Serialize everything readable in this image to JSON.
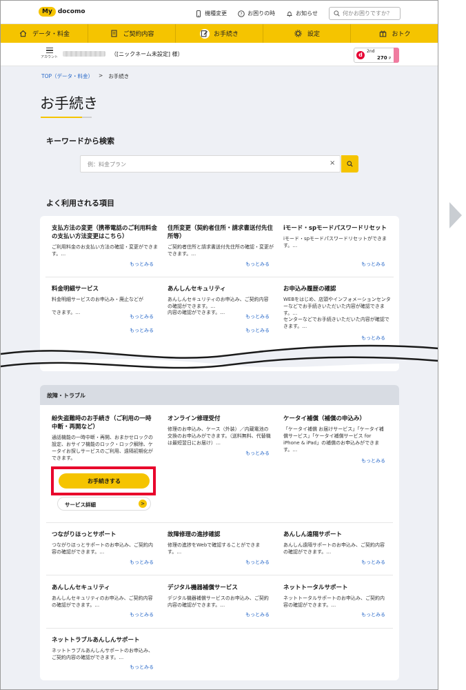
{
  "header": {
    "logo_my": "My",
    "logo_docomo": "docomo",
    "links": [
      {
        "label": "機種変更",
        "icon": "phone-icon"
      },
      {
        "label": "お困りの時",
        "icon": "help-icon"
      },
      {
        "label": "お知らせ",
        "icon": "bell-icon"
      }
    ],
    "search_placeholder": "何かお困りですか？"
  },
  "nav": [
    {
      "label": "データ・料金",
      "icon": "home-icon"
    },
    {
      "label": "ご契約内容",
      "icon": "document-icon"
    },
    {
      "label": "お手続き",
      "icon": "edit-icon",
      "active": true
    },
    {
      "label": "設定",
      "icon": "gear-icon"
    },
    {
      "label": "おトク",
      "icon": "gift-icon"
    }
  ],
  "account": {
    "menu_label": "アカウント",
    "nickname": "（[ニックネーム未設定] 様）",
    "d_label": "d",
    "rank": "2nd",
    "points": "270",
    "point_unit": "P"
  },
  "breadcrumb": {
    "home": "TOP（データ・料金）",
    "separator": ">",
    "current": "お手続き"
  },
  "page_title": "お手続き",
  "keyword": {
    "heading": "キーワードから検索",
    "placeholder": "例：料金プラン",
    "clear": "×"
  },
  "frequent": {
    "heading": "よく利用される項目",
    "items": [
      {
        "title": "支払方法の変更（携帯電話のご利用料金の支払い方法変更はこちら）",
        "desc": "ご利用料金のお支払い方法の確認・変更ができます。…",
        "more": "もっとみる"
      },
      {
        "title": "住所変更（契約者住所・請求書送付先住所等）",
        "desc": "ご契約者住所と請求書送付先住所の確認・変更ができます。…",
        "more": "もっとみる"
      },
      {
        "title": "iモード・spモードパスワードリセット",
        "desc": "iモード・spモードパスワードリセットができます。…",
        "more": "もっとみる"
      },
      {
        "title": "料金明細サービス",
        "desc": "料金明細サービスのお申込み・廃止などが",
        "desc2": "できます。…",
        "more": "もっとみる",
        "more2": "もっとみる"
      },
      {
        "title": "あんしんセキュリティ",
        "desc": "あんしんセキュリティのお申込み、ご契約内容の確認ができます。…",
        "desc2": "内容の確認ができます。…",
        "more": "もっとみる",
        "more2": "もっとみる"
      },
      {
        "title": "お申込み履歴の確認",
        "desc": "WEBをはじめ、店頭やインフォメーションセンターなどでお手続きいただいた内容が確認できます。…",
        "desc2": "センターなどでお手続きいただいた内容が確認できます。…",
        "more": "もっとみる"
      }
    ]
  },
  "trouble": {
    "heading": "故障・トラブル",
    "items": [
      {
        "title": "紛失盗難時のお手続き（ご利用の一時中断・再開など）",
        "desc": "通話機能の一時中断・再開、おまかせロックの設定、おサイフ機能のロック・ロック解除、ケータイお探しサービスのご利用、遠隔初期化ができます。"
      },
      {
        "title": "オンライン修理受付",
        "desc": "修理のお申込み、ケース（外装）／内蔵電池の交換のお申込みができます。（送料無料、代替機は最短翌日にお届け）…",
        "more": "もっとみる"
      },
      {
        "title": "ケータイ補償（補償の申込み）",
        "desc": "「ケータイ補償 お届けサービス」「ケータイ補償サービス」「ケータイ補償サービス for iPhone & iPad」の補償のお申込みができます。…",
        "more": "もっとみる"
      },
      {
        "title": "つながりほっとサポート",
        "desc": "つながりほっとサポートのお申込み、ご契約内容の確認ができます。…",
        "more": "もっとみる"
      },
      {
        "title": "故障修理の進捗確認",
        "desc": "修理の進捗をWebで確認することができます。…",
        "more": "もっとみる"
      },
      {
        "title": "あんしん遠隔サポート",
        "desc": "あんしん遠隔サポートのお申込み、ご契約内容の確認ができます。…",
        "more": "もっとみる"
      },
      {
        "title": "あんしんセキュリティ",
        "desc": "あんしんセキュリティのお申込み、ご契約内容の確認ができます。…",
        "more": "もっとみる"
      },
      {
        "title": "デジタル機器補償サービス",
        "desc": "デジタル機器補償サービスのお申込み、ご契約内容の確認ができます。…",
        "more": "もっとみる"
      },
      {
        "title": "ネットトータルサポート",
        "desc": "ネットトータルサポートのお申込み、ご契約内容の確認ができます。…",
        "more": "もっとみる"
      },
      {
        "title": "ネットトラブルあんしんサポート",
        "desc": "ネットトラブルあんしんサポートのお申込み、ご契約内容の確認ができます。…",
        "more": "もっとみる"
      }
    ],
    "apply_button": "お手続きする",
    "detail_button": "サービス詳細",
    "detail_go": ">"
  },
  "colors": {
    "brand_yellow": "#f5c400",
    "link_blue": "#2667c8",
    "highlight_red": "#e8002b"
  }
}
